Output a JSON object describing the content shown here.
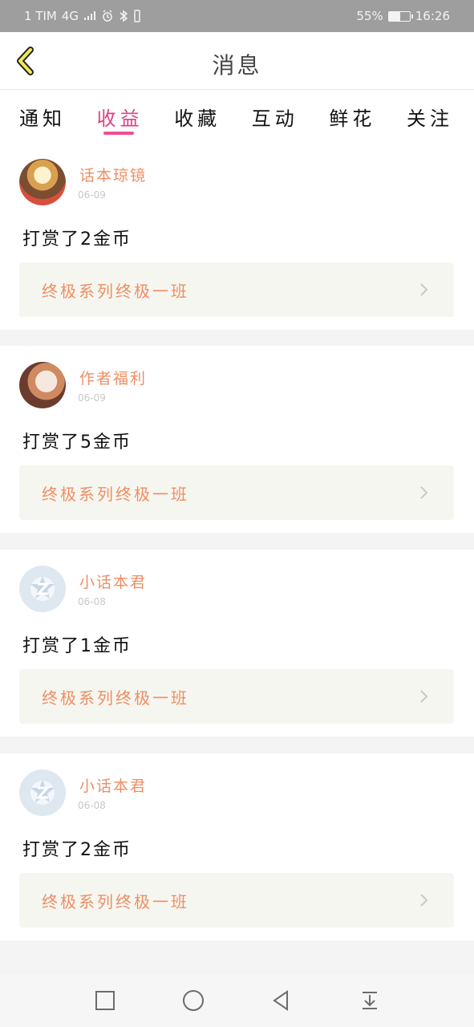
{
  "status_bar": {
    "carrier": "1 TIM",
    "network": "4G",
    "battery_percent": "55%",
    "battery_level": 0.55,
    "time": "16:26"
  },
  "header": {
    "title": "消息"
  },
  "tabs": [
    {
      "label": "通知",
      "active": false
    },
    {
      "label": "收益",
      "active": true
    },
    {
      "label": "收藏",
      "active": false
    },
    {
      "label": "互动",
      "active": false
    },
    {
      "label": "鲜花",
      "active": false
    },
    {
      "label": "关注",
      "active": false
    }
  ],
  "items": [
    {
      "author": "话本琼镜",
      "date": "06-09",
      "message": "打赏了2金币",
      "work": "终极系列终极一班",
      "avatar": "avatar-1"
    },
    {
      "author": "作者福利",
      "date": "06-09",
      "message": "打赏了5金币",
      "work": "终极系列终极一班",
      "avatar": "avatar-2"
    },
    {
      "author": "小话本君",
      "date": "06-08",
      "message": "打赏了1金币",
      "work": "终极系列终极一班",
      "avatar": "default-avatar"
    },
    {
      "author": "小话本君",
      "date": "06-08",
      "message": "打赏了2金币",
      "work": "终极系列终极一班",
      "avatar": "default-avatar"
    }
  ],
  "icons": {
    "back": "chevron-left-icon",
    "item": "chevron-right-icon",
    "nav": [
      "square-icon",
      "circle-icon",
      "triangle-back-icon",
      "download-arrow-icon"
    ]
  },
  "colors": {
    "accent_pink": "#ef4f92",
    "accent_orange": "#ef8e64",
    "back_yellow": "#f3e85b"
  }
}
